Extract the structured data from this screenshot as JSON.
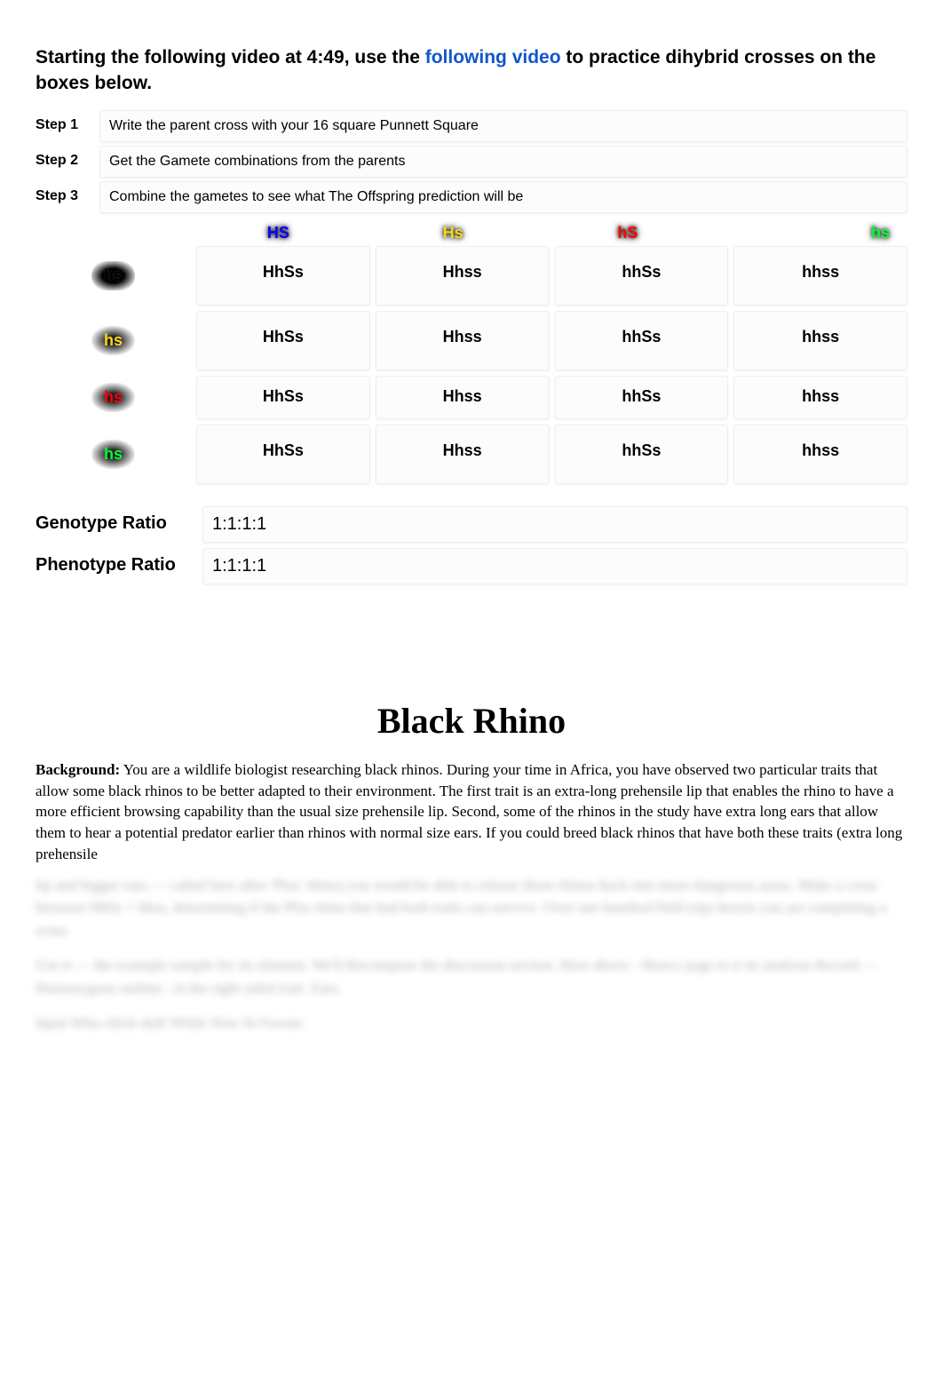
{
  "intro": {
    "prefix": "Starting the following video at 4:49, use the ",
    "link_text": "following video",
    "suffix": " to practice dihybrid crosses on the boxes below."
  },
  "steps": [
    {
      "label": "Step 1",
      "text": "Write the parent cross with your 16 square Punnett Square"
    },
    {
      "label": "Step 2",
      "text": "Get the Gamete combinations from the parents"
    },
    {
      "label": "Step 3",
      "text": "Combine the gametes to see what The Offspring prediction will be"
    }
  ],
  "punnett": {
    "col_headers": [
      {
        "text": "HS",
        "color": "blue"
      },
      {
        "text": "Hs",
        "color": "yellow"
      },
      {
        "text": "hS",
        "color": "red"
      },
      {
        "text": "hs",
        "color": "green"
      }
    ],
    "row_headers": [
      {
        "text": "hs",
        "color": "black"
      },
      {
        "text": "hs",
        "color": "yellow"
      },
      {
        "text": "hs",
        "color": "red"
      },
      {
        "text": "hs",
        "color": "green"
      }
    ],
    "cells": [
      [
        "HhSs",
        "Hhss",
        "hhSs",
        "hhss"
      ],
      [
        "HhSs",
        "Hhss",
        "hhSs",
        "hhss"
      ],
      [
        "HhSs",
        "Hhss",
        "hhSs",
        "hhss"
      ],
      [
        "HhSs",
        "Hhss",
        "hhSs",
        "hhss"
      ]
    ]
  },
  "ratios": {
    "genotype_label": "Genotype Ratio",
    "genotype_value": "1:1:1:1",
    "phenotype_label": "Phenotype Ratio",
    "phenotype_value": "1:1:1:1"
  },
  "section2": {
    "title": "Black Rhino",
    "background_label": "Background:",
    "background_text": " You are a wildlife biologist researching black rhinos. During your time in Africa, you have observed two particular traits that allow some black rhinos to be better adapted to their environment. The first trait is an extra-long prehensile lip that enables the rhino to have a more efficient browsing capability than the usual size prehensile lip. Second, some of the rhinos in the study have extra long ears that allow them to hear a potential predator earlier than rhinos with normal size ears. If you could breed black rhinos that have both these traits (extra long prehensile",
    "faded_lines": [
      "lip and bigger ears — called here after 'Plus' rhino) you would be able to release these rhinos back into more dangerous areas. Make a cross between HhSs × hhss, determining if the Plus rhino that had both traits can survive. Over one hundred field trips herein you are completing a cross.",
      "Use it — the example sample for its element. We'll Recompose the discussion section. Here above - Heavy page to it its analysis Record — Homozygous outline : in the right sided trait. Ears.",
      "Input   Who chick skill\nWhile  New fit Favour"
    ]
  }
}
